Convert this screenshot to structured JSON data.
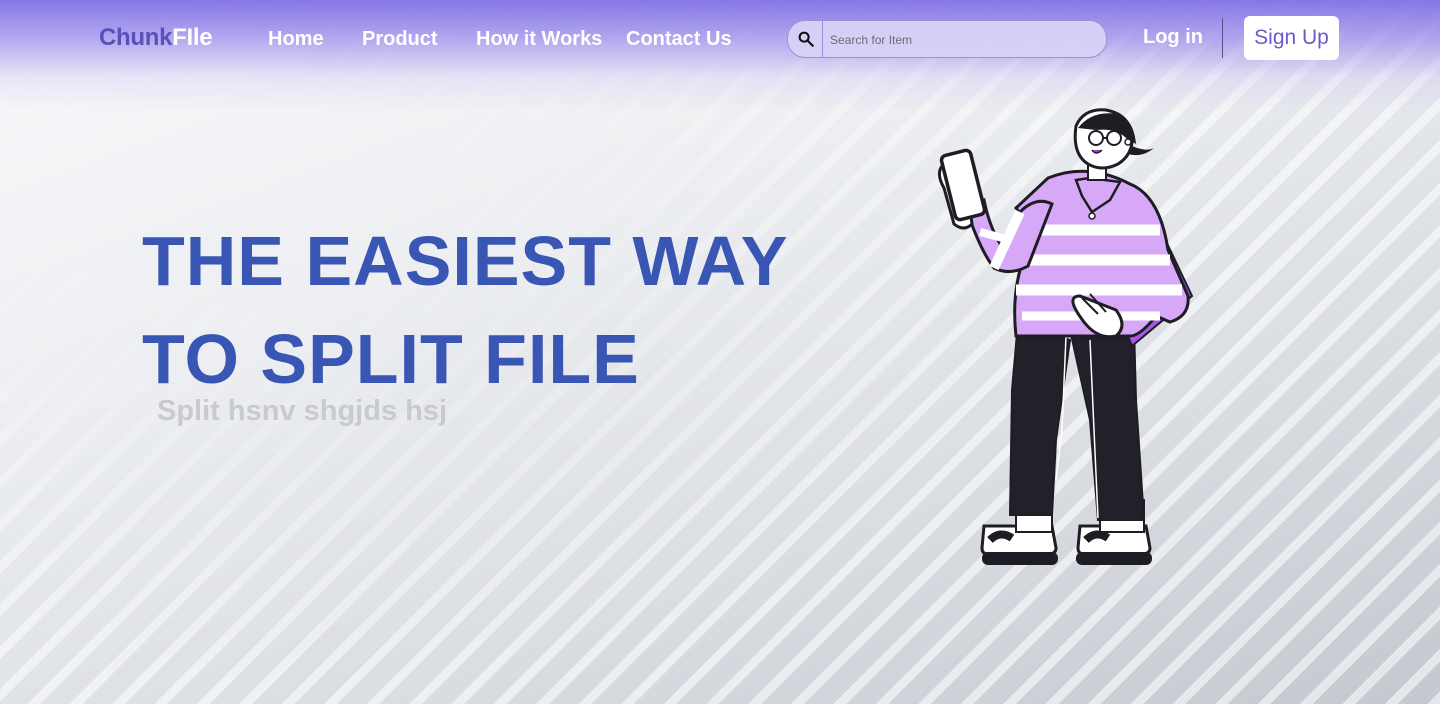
{
  "brand": {
    "part1": "Chunk",
    "part2": "FIle"
  },
  "nav": {
    "links": [
      {
        "label": "Home"
      },
      {
        "label": "Product"
      },
      {
        "label": "How it Works"
      },
      {
        "label": "Contact Us"
      }
    ]
  },
  "search": {
    "placeholder": "Search for Item",
    "value": "",
    "icon": "search-icon"
  },
  "auth": {
    "login_label": "Log in",
    "signup_label": "Sign Up"
  },
  "hero": {
    "line1": "THE EASIEST WAY",
    "line2": "TO SPLIT FILE",
    "subtitle": "Split hsnv shgjds  hsj"
  },
  "illustration": {
    "name": "woman-holding-phone-illustration"
  },
  "colors": {
    "brand_purple": "#5a50b8",
    "header_purple": "#8070e4",
    "hero_blue": "#3a56b4",
    "subtitle_gray": "#c9cad0",
    "signup_text": "#6a5cc8",
    "shirt_lilac": "#d7a8f8",
    "bag_purple": "#a855e8"
  }
}
